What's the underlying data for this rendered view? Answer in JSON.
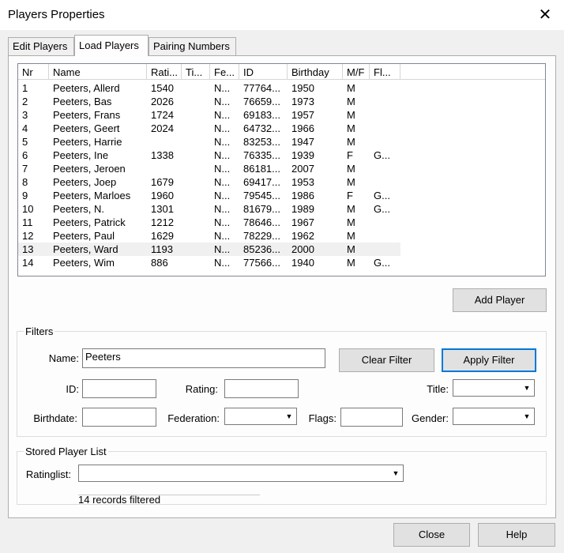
{
  "window": {
    "title": "Players Properties",
    "close_glyph": "✕"
  },
  "tabs": [
    {
      "label": "Edit Players",
      "active": false
    },
    {
      "label": "Load Players",
      "active": true
    },
    {
      "label": "Pairing Numbers",
      "active": false
    }
  ],
  "table": {
    "columns": [
      "Nr",
      "Name",
      "Rati...",
      "Ti...",
      "Fe...",
      "ID",
      "Birthday",
      "M/F",
      "Fl..."
    ],
    "rows": [
      [
        "1",
        "Peeters, Allerd",
        "1540",
        "",
        "N...",
        "77764...",
        "1950",
        "M",
        ""
      ],
      [
        "2",
        "Peeters, Bas",
        "2026",
        "",
        "N...",
        "76659...",
        "1973",
        "M",
        ""
      ],
      [
        "3",
        "Peeters, Frans",
        "1724",
        "",
        "N...",
        "69183...",
        "1957",
        "M",
        ""
      ],
      [
        "4",
        "Peeters, Geert",
        "2024",
        "",
        "N...",
        "64732...",
        "1966",
        "M",
        ""
      ],
      [
        "5",
        "Peeters, Harrie",
        "",
        "",
        "N...",
        "83253...",
        "1947",
        "M",
        ""
      ],
      [
        "6",
        "Peeters, Ine",
        "1338",
        "",
        "N...",
        "76335...",
        "1939",
        "F",
        "G..."
      ],
      [
        "7",
        "Peeters, Jeroen",
        "",
        "",
        "N...",
        "86181...",
        "2007",
        "M",
        ""
      ],
      [
        "8",
        "Peeters, Joep",
        "1679",
        "",
        "N...",
        "69417...",
        "1953",
        "M",
        ""
      ],
      [
        "9",
        "Peeters, Marloes",
        "1960",
        "",
        "N...",
        "79545...",
        "1986",
        "F",
        "G..."
      ],
      [
        "10",
        "Peeters, N.",
        "1301",
        "",
        "N...",
        "81679...",
        "1989",
        "M",
        "G..."
      ],
      [
        "11",
        "Peeters, Patrick",
        "1212",
        "",
        "N...",
        "78646...",
        "1967",
        "M",
        ""
      ],
      [
        "12",
        "Peeters, Paul",
        "1629",
        "",
        "N...",
        "78229...",
        "1962",
        "M",
        ""
      ],
      [
        "13",
        "Peeters, Ward",
        "1193",
        "",
        "N...",
        "85236...",
        "2000",
        "M",
        ""
      ],
      [
        "14",
        "Peeters, Wim",
        "886",
        "",
        "N...",
        "77566...",
        "1940",
        "M",
        "G..."
      ]
    ],
    "selected_row": 13
  },
  "buttons": {
    "add_player": "Add Player",
    "clear_filter": "Clear Filter",
    "apply_filter": "Apply Filter",
    "close": "Close",
    "help": "Help"
  },
  "filters": {
    "legend": "Filters",
    "name_label": "Name:",
    "name_value": "Peeters",
    "id_label": "ID:",
    "id_value": "",
    "rating_label": "Rating:",
    "rating_value": "",
    "title_label": "Title:",
    "title_value": "",
    "birthdate_label": "Birthdate:",
    "birthdate_value": "",
    "federation_label": "Federation:",
    "federation_value": "",
    "flags_label": "Flags:",
    "flags_value": "",
    "gender_label": "Gender:",
    "gender_value": ""
  },
  "stored": {
    "legend": "Stored Player List",
    "ratinglist_label": "Ratinglist:",
    "ratinglist_value": "",
    "status": "14 records filtered"
  },
  "icons": {
    "dropdown": "chevron-down-icon",
    "close": "close-icon"
  },
  "colors": {
    "accent": "#0078d7",
    "selected_row": "#f0f0f0",
    "background": "#f0f0f0"
  }
}
